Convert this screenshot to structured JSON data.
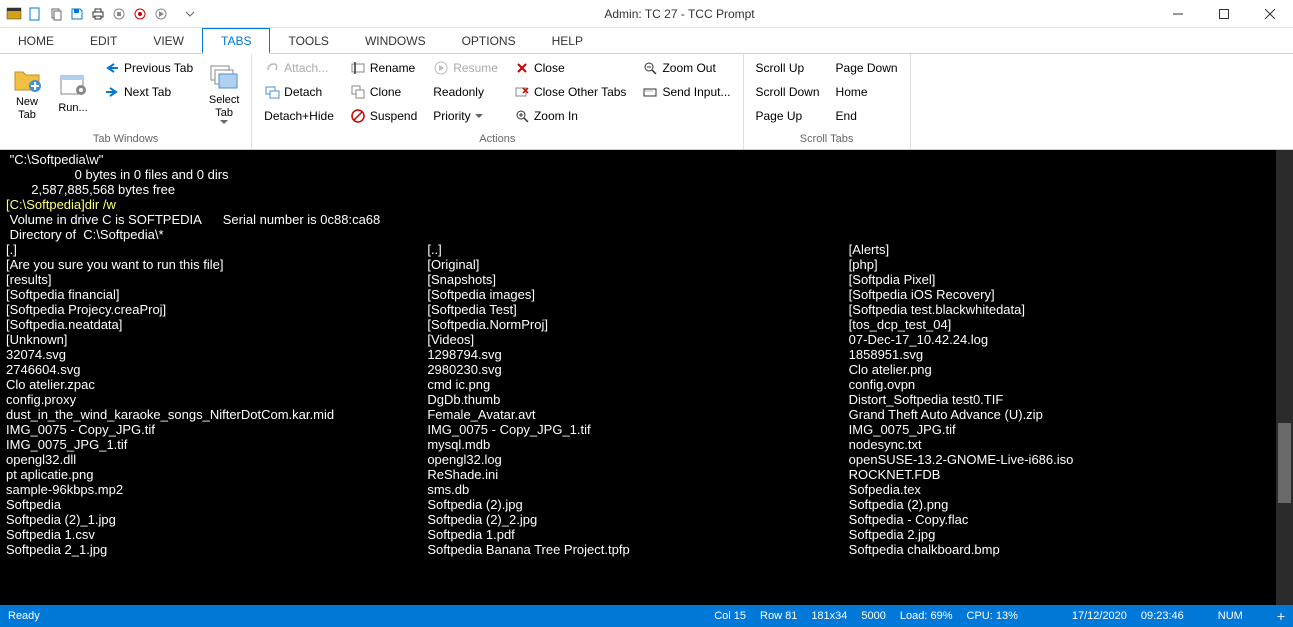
{
  "window": {
    "title": "Admin: TC 27 - TCC Prompt"
  },
  "menu": {
    "items": [
      "HOME",
      "EDIT",
      "VIEW",
      "TABS",
      "TOOLS",
      "WINDOWS",
      "OPTIONS",
      "HELP"
    ],
    "active_index": 3
  },
  "ribbon": {
    "groups": {
      "tab_windows": {
        "label": "Tab Windows",
        "new_tab": "New\nTab",
        "run": "Run...",
        "previous_tab": "Previous Tab",
        "next_tab": "Next Tab",
        "select_tab": "Select\nTab"
      },
      "actions": {
        "label": "Actions",
        "attach": "Attach...",
        "detach": "Detach",
        "detach_hide": "Detach+Hide",
        "rename": "Rename",
        "clone": "Clone",
        "suspend": "Suspend",
        "resume": "Resume",
        "readonly": "Readonly",
        "priority": "Priority",
        "close": "Close",
        "close_other": "Close Other Tabs",
        "zoom_in": "Zoom In",
        "zoom_out": "Zoom Out",
        "send_input": "Send Input..."
      },
      "scroll_tabs": {
        "label": "Scroll Tabs",
        "scroll_up": "Scroll Up",
        "scroll_down": "Scroll Down",
        "page_up": "Page Up",
        "page_down": "Page Down",
        "home": "Home",
        "end": "End"
      }
    }
  },
  "terminal": {
    "header": [
      " \"C:\\Softpedia\\w\"",
      "                   0 bytes in 0 files and 0 dirs",
      "       2,587,885,568 bytes free",
      "",
      "[C:\\Softpedia]dir /w",
      "",
      " Volume in drive C is SOFTPEDIA      Serial number is 0c88:ca68",
      " Directory of  C:\\Softpedia\\*",
      ""
    ],
    "col1": [
      "[.]",
      "[Are you sure you want to run this file]",
      "[results]",
      "[Softpedia financial]",
      "[Softpedia Projecy.creaProj]",
      "[Softpedia.neatdata]",
      "[Unknown]",
      "32074.svg",
      "2746604.svg",
      "Clo atelier.zpac",
      "config.proxy",
      "dust_in_the_wind_karaoke_songs_NifterDotCom.kar.mid",
      "IMG_0075 - Copy_JPG.tif",
      "IMG_0075_JPG_1.tif",
      "opengl32.dll",
      "pt aplicatie.png",
      "sample-96kbps.mp2",
      "Softpedia",
      "Softpedia (2)_1.jpg",
      "Softpedia 1.csv",
      "Softpedia 2_1.jpg"
    ],
    "col2": [
      "[..]",
      "[Original]",
      "[Snapshots]",
      "[Softpedia images]",
      "[Softpedia Test]",
      "[Softpedia.NormProj]",
      "[Videos]",
      "1298794.svg",
      "2980230.svg",
      "cmd ic.png",
      "DgDb.thumb",
      "Female_Avatar.avt",
      "IMG_0075 - Copy_JPG_1.tif",
      "mysql.mdb",
      "opengl32.log",
      "ReShade.ini",
      "sms.db",
      "Softpedia (2).jpg",
      "Softpedia (2)_2.jpg",
      "Softpedia 1.pdf",
      "Softpedia Banana Tree Project.tpfp"
    ],
    "col3": [
      "[Alerts]",
      "[php]",
      "[Softpdia Pixel]",
      "[Softpedia iOS Recovery]",
      "[Softpedia test.blackwhitedata]",
      "[tos_dcp_test_04]",
      "07-Dec-17_10.42.24.log",
      "1858951.svg",
      "Clo atelier.png",
      "config.ovpn",
      "Distort_Softpedia test0.TIF",
      "Grand Theft Auto Advance (U).zip",
      "IMG_0075_JPG.tif",
      "nodesync.txt",
      "openSUSE-13.2-GNOME-Live-i686.iso",
      "ROCKNET.FDB",
      "Sofpedia.tex",
      "Softpedia (2).png",
      "Softpedia - Copy.flac",
      "Softpedia 2.jpg",
      "Softpedia chalkboard.bmp"
    ]
  },
  "status": {
    "ready": "Ready",
    "col": "Col 15",
    "row": "Row 81",
    "size": "181x34",
    "buffer": "5000",
    "load": "Load: 69%",
    "cpu": "CPU: 13%",
    "date": "17/12/2020",
    "time": "09:23:46",
    "num": "NUM",
    "plus": "+"
  }
}
